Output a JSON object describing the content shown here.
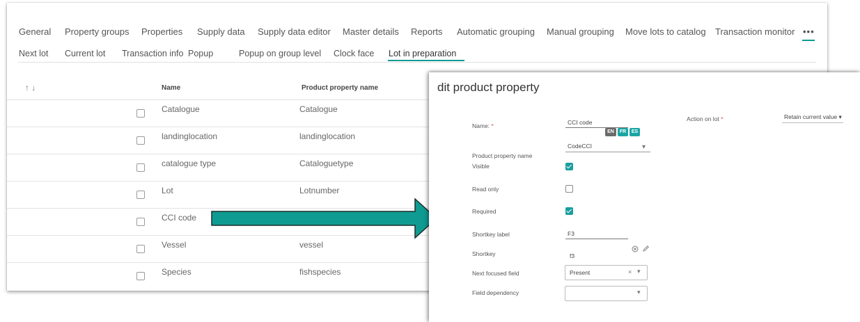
{
  "main_tabs": [
    "General",
    "Property groups",
    "Properties",
    "Supply data",
    "Supply data editor",
    "Master details",
    "Reports",
    "Automatic grouping",
    "Manual grouping",
    "Move lots to catalog",
    "Transaction monitor",
    "•••"
  ],
  "sub_tabs": [
    "Next lot",
    "Current lot",
    "Transaction info",
    "Popup",
    "Popup on group level",
    "Clock face",
    "Lot in preparation"
  ],
  "table": {
    "sort_label": "↑ ↓",
    "headers": {
      "name": "Name",
      "product_property_name": "Product property name"
    },
    "rows": [
      {
        "name": "Catalogue",
        "product_property_name": "Catalogue"
      },
      {
        "name": "landinglocation",
        "product_property_name": "landinglocation"
      },
      {
        "name": "catalogue type",
        "product_property_name": "Cataloguetype"
      },
      {
        "name": "Lot",
        "product_property_name": "Lotnumber"
      },
      {
        "name": "CCI code",
        "product_property_name": ""
      },
      {
        "name": "Vessel",
        "product_property_name": "vessel"
      },
      {
        "name": "Species",
        "product_property_name": "fishspecies"
      }
    ]
  },
  "panel": {
    "title": "dit product property",
    "name_label": "Name:",
    "name_value": "CCI code",
    "languages": [
      "EN",
      "FR",
      "ES"
    ],
    "action_label": "Action on lot",
    "action_value": "Retain current value",
    "product_property_label": "Product property name",
    "product_property_value": "CodeCCI",
    "visible_label": "Visible",
    "visible_checked": true,
    "read_only_label": "Read only",
    "read_only_checked": false,
    "required_label": "Required",
    "required_checked": true,
    "shortkey_label_label": "Shortkey label",
    "shortkey_label_value": "F3",
    "shortkey_title": "Shortkey",
    "shortkey_value": "f3",
    "next_focused_label": "Next focused field",
    "next_focused_value": "Present",
    "field_dependency_label": "Field dependency",
    "field_dependency_value": "",
    "required_marker": "*",
    "clear_glyph": "×",
    "dropdown_glyph": "▾"
  },
  "colors": {
    "accent": "#0a9a94",
    "arrow": "#0f9b92",
    "check": "#1a9e9e",
    "lang_en": "#6b6b6b",
    "lang_active": "#1aa5a5"
  }
}
